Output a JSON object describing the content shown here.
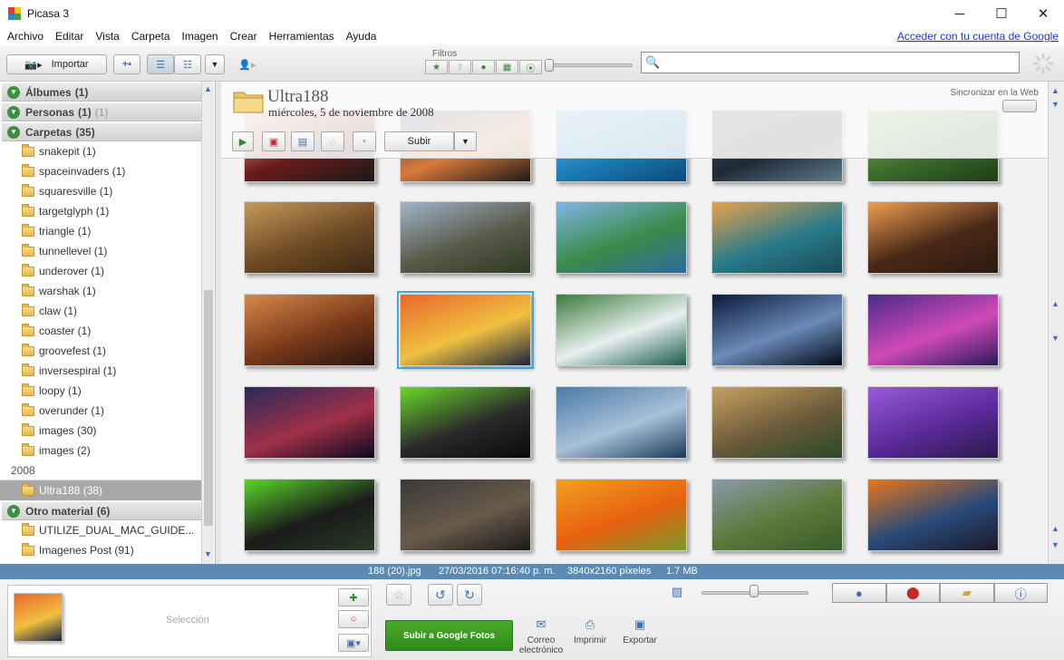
{
  "window": {
    "title": "Picasa 3",
    "logo_colors": [
      "#e53935",
      "#fbc02d",
      "#43a047",
      "#1e88e5"
    ],
    "controls": {
      "minimize": "─",
      "maximize": "☐",
      "close": "✕"
    }
  },
  "menu": {
    "items": [
      "Archivo",
      "Editar",
      "Vista",
      "Carpeta",
      "Imagen",
      "Crear",
      "Herramientas",
      "Ayuda"
    ],
    "signin_link": "Acceder con tu cuenta de Google"
  },
  "toolbar": {
    "import_label": "Importar",
    "filters_label": "Filtros",
    "search_value": "",
    "search_placeholder": "",
    "filter_icons": [
      "star-icon",
      "upload-arrow-icon",
      "person-icon",
      "film-icon",
      "pin-icon"
    ]
  },
  "sidebar": {
    "albums": {
      "label": "Álbumes",
      "count": "(1)"
    },
    "people": {
      "label": "Personas",
      "count": "(1)",
      "extra": "(1)"
    },
    "folders": {
      "label": "Carpetas",
      "count": "(35)"
    },
    "folder_items": [
      "snakepit (1)",
      "spaceinvaders (1)",
      "squaresville (1)",
      "targetglyph (1)",
      "triangle (1)",
      "tunnellevel (1)",
      "underover (1)",
      "warshak (1)",
      "claw (1)",
      "coaster (1)",
      "groovefest (1)",
      "inversespiral (1)",
      "loopy (1)",
      "overunder (1)",
      "images (30)",
      "images (2)"
    ],
    "year": "2008",
    "selected_folder": "Ultra188 (38)",
    "other": {
      "label": "Otro material",
      "count": "(6)"
    },
    "other_items": [
      "UTILIZE_DUAL_MAC_GUIDE...",
      "Imagenes Post (91)"
    ]
  },
  "album": {
    "title": "Ultra188",
    "date": "miércoles, 5 de noviembre de 2008",
    "sync_label": "Sincronizar en la Web",
    "upload_label": "Subir"
  },
  "photos": [
    {
      "colors": [
        "#ffb9a1",
        "#6a1b1b",
        "#1a1a1a"
      ]
    },
    {
      "colors": [
        "#1e3c72",
        "#d9793a",
        "#1a1a1a"
      ]
    },
    {
      "colors": [
        "#5bb8e8",
        "#1d7fb8",
        "#0b4a78"
      ]
    },
    {
      "colors": [
        "#3b4a5c",
        "#1f2a36",
        "#5f7a8c"
      ]
    },
    {
      "colors": [
        "#8fbc5a",
        "#3c6e2e",
        "#1f3d16"
      ]
    },
    {
      "colors": [
        "#c49a5a",
        "#6e4a24",
        "#3a2814"
      ]
    },
    {
      "colors": [
        "#9fb4c8",
        "#5a5a4a",
        "#2e3a20"
      ]
    },
    {
      "colors": [
        "#7fb6e8",
        "#3c8a4a",
        "#2e6aa0"
      ]
    },
    {
      "colors": [
        "#e8a24a",
        "#2a7a8a",
        "#1a4a5a"
      ]
    },
    {
      "colors": [
        "#f0a050",
        "#4a2818",
        "#2a1a10"
      ]
    },
    {
      "colors": [
        "#d8884a",
        "#7a3a1a",
        "#2a1410"
      ]
    },
    {
      "colors": [
        "#e8682a",
        "#f0c040",
        "#1a2440"
      ]
    },
    {
      "colors": [
        "#3a7a3a",
        "#e8f0f0",
        "#1a5a4a"
      ]
    },
    {
      "colors": [
        "#0a1a3a",
        "#6a8ab8",
        "#020818"
      ]
    },
    {
      "colors": [
        "#4a2a8a",
        "#d04ab8",
        "#2a1a5a"
      ]
    },
    {
      "colors": [
        "#2a2a5a",
        "#a03048",
        "#0a0a20"
      ]
    },
    {
      "colors": [
        "#6ad82a",
        "#2a2a2a",
        "#0a0a0a"
      ]
    },
    {
      "colors": [
        "#4a7aa8",
        "#a8c0d8",
        "#1a3a58"
      ]
    },
    {
      "colors": [
        "#c8a060",
        "#6a5a3a",
        "#2a4a28"
      ]
    },
    {
      "colors": [
        "#9a5ad8",
        "#5a2a9a",
        "#2a1a4a"
      ]
    },
    {
      "colors": [
        "#5ad82a",
        "#1a1a1a",
        "#2a3a2a"
      ]
    },
    {
      "colors": [
        "#3a3a3a",
        "#6a5a4a",
        "#1a1a1a"
      ]
    },
    {
      "colors": [
        "#f0a020",
        "#e86010",
        "#7a9a2a"
      ]
    },
    {
      "colors": [
        "#8a9aa8",
        "#5a7a3a",
        "#3a5a2a"
      ]
    },
    {
      "colors": [
        "#e8781a",
        "#2a4a7a",
        "#1a1a2a"
      ]
    }
  ],
  "status": {
    "filename": "188 (20).jpg",
    "datetime": "27/03/2016 07:16:40 p. m.",
    "dimensions": "3840x2160 píxeles",
    "size": "1.7 MB"
  },
  "tray": {
    "selection_label": "Selección",
    "upload_google_label": "Subir a Google Fotos",
    "email_label": [
      "Correo",
      "electrónico"
    ],
    "print_label": "Imprimir",
    "export_label": "Exportar",
    "info_tab_icons": [
      "person-icon",
      "map-pin-icon",
      "tag-icon",
      "info-icon"
    ]
  }
}
